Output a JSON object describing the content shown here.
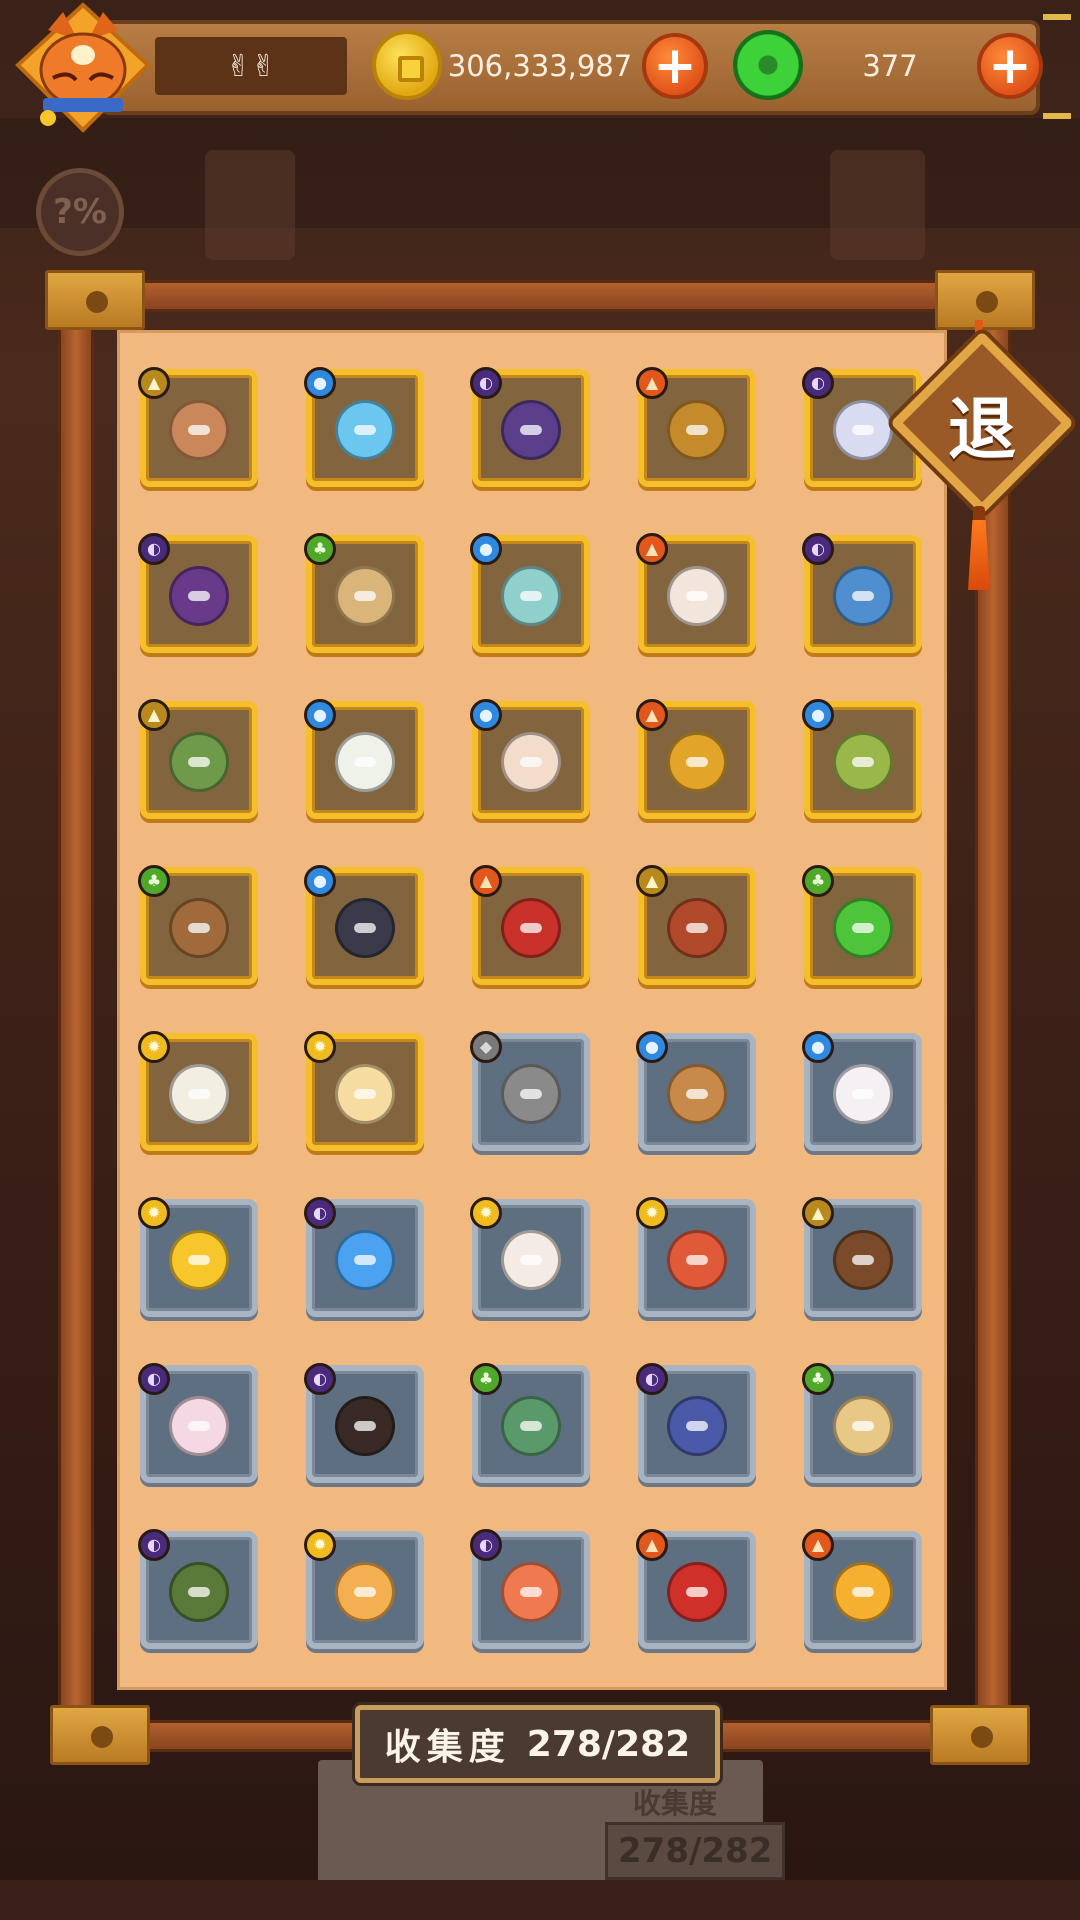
{
  "hud": {
    "player_name": "✌✌",
    "coins": "306,333,987",
    "gems": "377",
    "add_label": "+"
  },
  "exit": {
    "label": "退"
  },
  "collection": {
    "label": "收集度",
    "value": "278/282"
  },
  "background": {
    "hint_badge": "?%",
    "note_label": "收集度",
    "note_value": "278/282"
  },
  "colors": {
    "parchment": "#f1b97f",
    "frame": "#b86430",
    "card_collected_border": "#f4bf2a",
    "card_uncollected_border": "#a8b4c2",
    "coin": "#e0a812",
    "gem": "#3dd23a",
    "plus_button": "#e0541a"
  },
  "grid": {
    "partial_row": [
      {
        "state": "collected"
      },
      {
        "state": "collected"
      },
      {
        "state": "collected"
      },
      {
        "state": "collected"
      },
      {
        "state": "collected"
      }
    ],
    "rows": [
      [
        {
          "name": "cake-item",
          "element": "earth",
          "state": "collected",
          "color": "#c9875a"
        },
        {
          "name": "slime-blue-item",
          "element": "water",
          "state": "collected",
          "color": "#6bc7ef"
        },
        {
          "name": "ninja-item",
          "element": "dark",
          "state": "collected",
          "color": "#5b3f8a"
        },
        {
          "name": "hook-item",
          "element": "fire",
          "state": "collected",
          "color": "#c48a2c"
        },
        {
          "name": "rice-ball-item",
          "element": "dark",
          "state": "collected",
          "color": "#d9dcf0"
        }
      ],
      [
        {
          "name": "crow-item",
          "element": "dark",
          "state": "collected",
          "color": "#6a3a8a"
        },
        {
          "name": "scroll-baby-item",
          "element": "nature",
          "state": "collected",
          "color": "#d9b57a"
        },
        {
          "name": "vase-item",
          "element": "water",
          "state": "collected",
          "color": "#8fd0cc"
        },
        {
          "name": "cat-item",
          "element": "fire",
          "state": "collected",
          "color": "#f2e6dc"
        },
        {
          "name": "tissue-item",
          "element": "dark",
          "state": "collected",
          "color": "#4f8fd0"
        }
      ],
      [
        {
          "name": "tea-packet-item",
          "element": "earth",
          "state": "collected",
          "color": "#6f9a4a"
        },
        {
          "name": "white-flower-item",
          "element": "water",
          "state": "collected",
          "color": "#eef2e8"
        },
        {
          "name": "lotus-item",
          "element": "water",
          "state": "collected",
          "color": "#f4dccb"
        },
        {
          "name": "leaf-item",
          "element": "fire",
          "state": "collected",
          "color": "#e2a52a"
        },
        {
          "name": "bamboo-item",
          "element": "water",
          "state": "collected",
          "color": "#9ab84a"
        }
      ],
      [
        {
          "name": "gourd-item",
          "element": "nature",
          "state": "collected",
          "color": "#a06a3a"
        },
        {
          "name": "sword-item",
          "element": "water",
          "state": "collected",
          "color": "#3a3a4a"
        },
        {
          "name": "scarf-item",
          "element": "fire",
          "state": "collected",
          "color": "#c8322a"
        },
        {
          "name": "drum-item",
          "element": "earth",
          "state": "collected",
          "color": "#b04a2a"
        },
        {
          "name": "slime-green-item",
          "element": "nature",
          "state": "collected",
          "color": "#4ec43a"
        }
      ],
      [
        {
          "name": "feather-item",
          "element": "light",
          "state": "collected",
          "color": "#f2eee2"
        },
        {
          "name": "egg-item",
          "element": "light",
          "state": "collected",
          "color": "#f6dca0"
        },
        {
          "name": "stone-item",
          "element": "metal",
          "state": "uncollected",
          "color": "#8a8a8a"
        },
        {
          "name": "rune-stone-item",
          "element": "water",
          "state": "uncollected",
          "color": "#c88a4a"
        },
        {
          "name": "card-item",
          "element": "water",
          "state": "uncollected",
          "color": "#f4f0f4"
        }
      ],
      [
        {
          "name": "star-item",
          "element": "light",
          "state": "uncollected",
          "color": "#f6c62a"
        },
        {
          "name": "snowflake-item",
          "element": "dark",
          "state": "uncollected",
          "color": "#4aa2f0"
        },
        {
          "name": "reindeer-item",
          "element": "light",
          "state": "uncollected",
          "color": "#f4ece4"
        },
        {
          "name": "blanket-item",
          "element": "light",
          "state": "uncollected",
          "color": "#e05a3a"
        },
        {
          "name": "hooded-item",
          "element": "earth",
          "state": "uncollected",
          "color": "#7a4a2a"
        }
      ],
      [
        {
          "name": "bone-item",
          "element": "dark",
          "state": "uncollected",
          "color": "#f4d8e4"
        },
        {
          "name": "cookie-item",
          "element": "dark",
          "state": "uncollected",
          "color": "#3a2a26"
        },
        {
          "name": "fish-item",
          "element": "nature",
          "state": "uncollected",
          "color": "#5a9a6a"
        },
        {
          "name": "card-pack-item",
          "element": "dark",
          "state": "uncollected",
          "color": "#4a5aa8"
        },
        {
          "name": "crystal-ball-item",
          "element": "nature",
          "state": "uncollected",
          "color": "#e8c886"
        }
      ],
      [
        {
          "name": "chopsticks-item",
          "element": "dark",
          "state": "uncollected",
          "color": "#5a7a3a"
        },
        {
          "name": "pufferfish-item",
          "element": "light",
          "state": "uncollected",
          "color": "#f4b050"
        },
        {
          "name": "sushi-item",
          "element": "dark",
          "state": "uncollected",
          "color": "#f07a50"
        },
        {
          "name": "lantern-item",
          "element": "fire",
          "state": "uncollected",
          "color": "#d0302a"
        },
        {
          "name": "helicopter-chick-item",
          "element": "fire",
          "state": "uncollected",
          "color": "#f6b030"
        }
      ]
    ]
  }
}
